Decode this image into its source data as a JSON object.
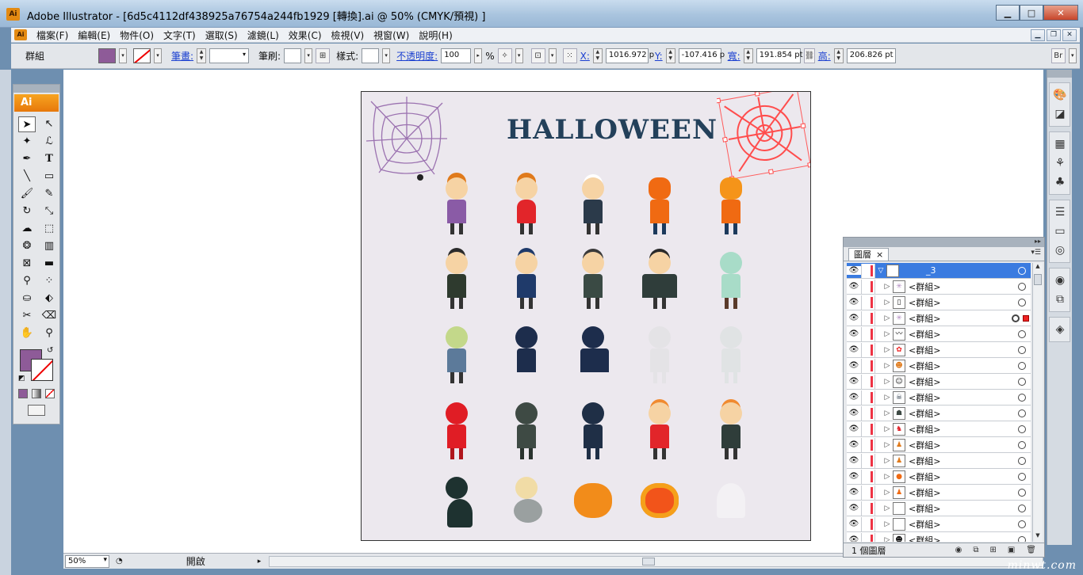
{
  "window": {
    "app_logo": "Ai",
    "title": "Adobe Illustrator - [6d5c4112df438925a76754a244fb1929 [轉換].ai @ 50% (CMYK/預視) ]"
  },
  "menu": {
    "items": [
      "檔案(F)",
      "編輯(E)",
      "物件(O)",
      "文字(T)",
      "選取(S)",
      "濾鏡(L)",
      "效果(C)",
      "檢視(V)",
      "視窗(W)",
      "說明(H)"
    ]
  },
  "control": {
    "selection_type": "群組",
    "fill_color": "#8e5b98",
    "stroke_label": "筆畫:",
    "brush_label": "筆刷:",
    "style_label": "樣式:",
    "opacity_label": "不透明度:",
    "opacity_value": "100",
    "opacity_unit": "%",
    "x_label": "X:",
    "x_value": "1016.972 p",
    "y_label": "Y:",
    "y_value": "-107.416 p",
    "w_label": "寬:",
    "w_value": "191.854 pt",
    "h_label": "高:",
    "h_value": "206.826 pt"
  },
  "toolbox": {
    "logo": "Ai",
    "tools": [
      "selection-tool",
      "direct-selection-tool",
      "magic-wand-tool",
      "lasso-tool",
      "pen-tool",
      "type-tool",
      "line-tool",
      "rectangle-tool",
      "paintbrush-tool",
      "pencil-tool",
      "rotate-tool",
      "scale-tool",
      "warp-tool",
      "free-transform-tool",
      "symbol-sprayer-tool",
      "graph-tool",
      "mesh-tool",
      "gradient-tool",
      "eyedropper-tool",
      "blend-tool",
      "live-paint-tool",
      "live-paint-selection-tool",
      "slice-tool",
      "eraser-tool",
      "hand-tool",
      "zoom-tool"
    ],
    "fill_color": "#8e5b98"
  },
  "artboard": {
    "title_text": "HALLOWEEN"
  },
  "status": {
    "zoom": "50%",
    "state": "開啟"
  },
  "layers": {
    "tab_label": "圖層",
    "tab_close": "×",
    "top_layer": "_3",
    "items": [
      "<群組>",
      "<群組>",
      "<群組>",
      "<群組>",
      "<群組>",
      "<群組>",
      "<群組>",
      "<群組>",
      "<群組>",
      "<群組>",
      "<群組>",
      "<群組>",
      "<群組>",
      "<群組>",
      "<群組>",
      "<群組>",
      "<群組>"
    ],
    "footer": "1 個圖層",
    "selected_color": "#e22222"
  },
  "watermark": "minwt.com"
}
